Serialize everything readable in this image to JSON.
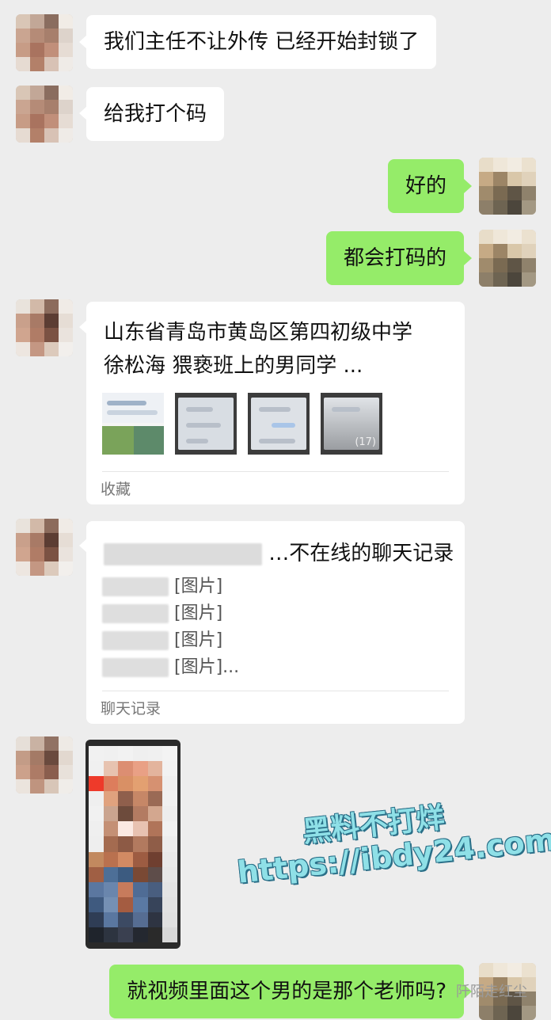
{
  "messages": {
    "m1": "我们主任不让外传 已经开始封锁了",
    "m2": "给我打个码",
    "m3": "好的",
    "m4": "都会打码的",
    "m10": "就视频里面这个男的是那个老师吗?"
  },
  "shared_card": {
    "title": "山东省青岛市黄岛区第四初级中学  徐松海  猥亵班上的男同学 ...",
    "thumb_count": "(17)",
    "footer": "收藏"
  },
  "chat_record_card": {
    "title": "…不在线的聊天记录",
    "lines": [
      "[图片]",
      "[图片]",
      "[图片]",
      "[图片]..."
    ],
    "footer": "聊天记录"
  },
  "watermark": {
    "line1": "黑料不打烊",
    "line2": "https://ibdy24.com",
    "corner": "阡陌走红尘"
  },
  "colors": {
    "background": "#ededed",
    "incoming_bubble": "#ffffff",
    "outgoing_bubble": "#95ec69",
    "watermark": "#8fe0e7"
  }
}
